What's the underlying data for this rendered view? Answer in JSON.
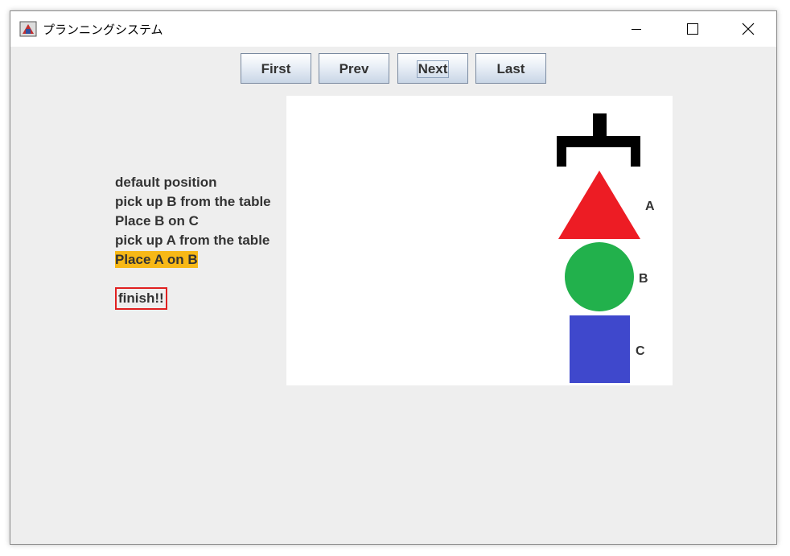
{
  "window": {
    "title": "プランニングシステム",
    "icon": "java-app-icon",
    "controls": [
      "minimize-icon",
      "maximize-icon",
      "close-icon"
    ]
  },
  "toolbar": {
    "first_label": "First",
    "prev_label": "Prev",
    "next_label": "Next",
    "last_label": "Last"
  },
  "steps": [
    {
      "text": "default position"
    },
    {
      "text": "pick up B from the table"
    },
    {
      "text": "Place B on C"
    },
    {
      "text": "pick up A from the table"
    },
    {
      "text": "Place A on B",
      "current": true
    }
  ],
  "finish_text": "finish!!",
  "scene": {
    "gripper": "crane-gripper",
    "blocks": [
      {
        "label": "A",
        "shape": "triangle",
        "color": "#ed1c24"
      },
      {
        "label": "B",
        "shape": "circle",
        "color": "#22b14c"
      },
      {
        "label": "C",
        "shape": "square",
        "color": "#3f48cc"
      }
    ]
  },
  "colors": {
    "current_step_highlight": "#f7b817",
    "finish_border": "#e02020"
  }
}
